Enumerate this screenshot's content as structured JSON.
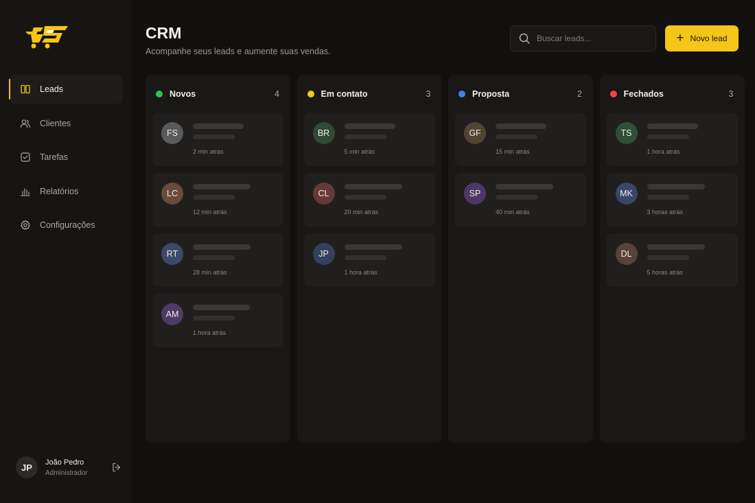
{
  "sidebar": {
    "logo_icon": "cart-logo-icon",
    "items": [
      {
        "label": "Leads",
        "icon": "columns-icon",
        "active": true
      },
      {
        "label": "Clientes",
        "icon": "users-icon",
        "active": false
      },
      {
        "label": "Tarefas",
        "icon": "checkbox-icon",
        "active": false
      },
      {
        "label": "Relatórios",
        "icon": "bar-chart-icon",
        "active": false
      },
      {
        "label": "Configurações",
        "icon": "gear-icon",
        "active": false
      }
    ],
    "user": {
      "initials": "JP",
      "name": "João Pedro",
      "role": "Administrador"
    }
  },
  "header": {
    "title": "CRM",
    "subtitle": "Acompanhe seus leads e aumente suas vendas.",
    "search_placeholder": "Buscar leads...",
    "new_lead_label": "Novo lead"
  },
  "colors": {
    "accent": "#f5c518",
    "green": "#2ec642",
    "yellow": "#f5c518",
    "blue": "#3b82f6",
    "red": "#ef4444"
  },
  "columns": [
    {
      "name": "Novos",
      "count": "4",
      "color": "#2ec642",
      "cards": [
        {
          "initials": "FS",
          "time": "2 min atrás",
          "avatar_color": "#5a5a5c"
        },
        {
          "initials": "LC",
          "time": "12 min atrás",
          "avatar_color": "#6a4a3a"
        },
        {
          "initials": "RT",
          "time": "28 min atrás",
          "avatar_color": "#3b4a66"
        },
        {
          "initials": "AM",
          "time": "1 hora atrás",
          "avatar_color": "#4e3a66"
        }
      ]
    },
    {
      "name": "Em contato",
      "count": "3",
      "color": "#f5c518",
      "cards": [
        {
          "initials": "BR",
          "time": "5 min atrás",
          "avatar_color": "#2f4a36"
        },
        {
          "initials": "CL",
          "time": "20 min atrás",
          "avatar_color": "#663a3a"
        },
        {
          "initials": "JP",
          "time": "1 hora atrás",
          "avatar_color": "#33405e"
        }
      ]
    },
    {
      "name": "Proposta",
      "count": "2",
      "color": "#3b82f6",
      "cards": [
        {
          "initials": "GF",
          "time": "15 min atrás",
          "avatar_color": "#4f4530"
        },
        {
          "initials": "SP",
          "time": "40 min atrás",
          "avatar_color": "#4d3766"
        }
      ]
    },
    {
      "name": "Fechados",
      "count": "3",
      "color": "#ef4444",
      "cards": [
        {
          "initials": "TS",
          "time": "1 hora atrás",
          "avatar_color": "#2f4f36"
        },
        {
          "initials": "MK",
          "time": "3 horas atrás",
          "avatar_color": "#3a4666"
        },
        {
          "initials": "DL",
          "time": "5 horas atrás",
          "avatar_color": "#56433a"
        }
      ]
    }
  ]
}
